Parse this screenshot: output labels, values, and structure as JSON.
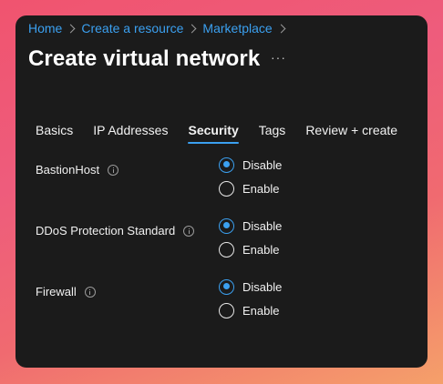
{
  "breadcrumb": {
    "items": [
      "Home",
      "Create a resource",
      "Marketplace"
    ]
  },
  "page": {
    "title": "Create virtual network",
    "more_label": "···"
  },
  "tabs": [
    {
      "label": "Basics",
      "active": false
    },
    {
      "label": "IP Addresses",
      "active": false
    },
    {
      "label": "Security",
      "active": true
    },
    {
      "label": "Tags",
      "active": false
    },
    {
      "label": "Review + create",
      "active": false
    }
  ],
  "settings": [
    {
      "label": "BastionHost",
      "options": [
        "Disable",
        "Enable"
      ],
      "selected": "Disable"
    },
    {
      "label": "DDoS Protection Standard",
      "options": [
        "Disable",
        "Enable"
      ],
      "selected": "Disable"
    },
    {
      "label": "Firewall",
      "options": [
        "Disable",
        "Enable"
      ],
      "selected": "Disable"
    }
  ],
  "colors": {
    "accent": "#3ba0f0",
    "panel": "#1b1b1b"
  }
}
